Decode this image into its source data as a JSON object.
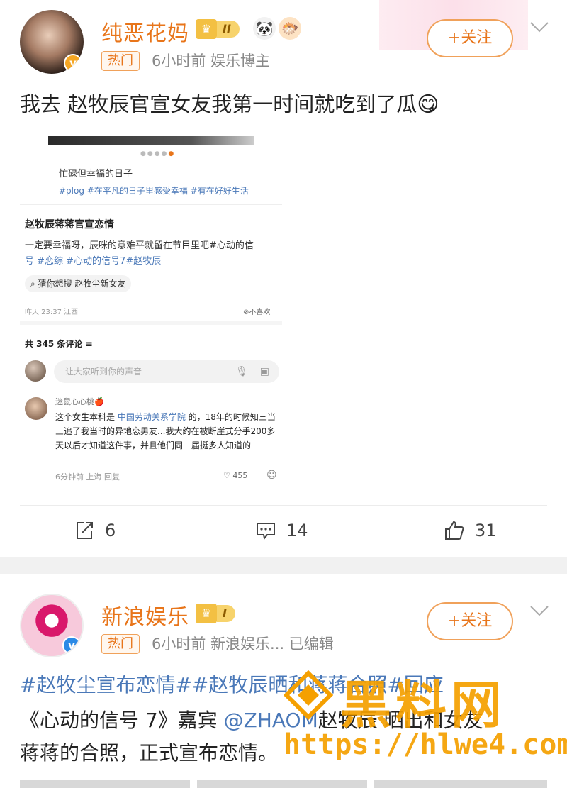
{
  "post1": {
    "username": "纯恶花妈",
    "rank_level": "II",
    "emoji_icons": [
      "panda-icon",
      "pufferfish-icon"
    ],
    "hot_tag": "热门",
    "meta": "6小时前  娱乐博主",
    "follow_label": "+关注",
    "text": "我去 赵牧辰官宣女友我第一时间就吃到了瓜",
    "embed": {
      "caption_title": "忙碌但幸福的日子",
      "caption_tags": "#plog #在平凡的日子里感受幸福 #有在好好生活",
      "article_title": "赵牧辰蒋蒋官宣恋情",
      "article_body_line1": "一定要幸福呀，辰咪的意难平就留在节目里吧#心动的信",
      "article_body_line2": "号 #恋综 #心动的信号7#赵牧辰",
      "guess_label": "猜你想搜  赵牧尘新女友",
      "published": "昨天 23:37 江西",
      "dislike": "不喜欢",
      "comment_count": "共 345 条评论",
      "comment_placeholder": "让大家听到你的声音",
      "comment": {
        "name": "迷鼠心心桃",
        "text_pre": "这个女生本科是 ",
        "text_link": "中国劳动关系学院",
        "text_post": " 的，18年的时候知三当三追了我当时的异地恋男友...我大约在被断崖式分手200多天以后才知道这件事，并且他们同一届挺多人知道的",
        "time_loc": "6分钟前 上海  回复",
        "likes": "455"
      }
    },
    "actions": {
      "share_count": "6",
      "comment_count": "14",
      "like_count": "31"
    }
  },
  "post2": {
    "username": "新浪娱乐",
    "rank_level": "I",
    "hot_tag": "热门",
    "meta": "6小时前  新浪娱乐...  已编辑",
    "follow_label": "+关注",
    "hashtags": "#赵牧尘宣布恋情##赵牧辰晒和蒋蒋合照#回应",
    "line2_pre": "《心动的信号 7》嘉宾 ",
    "line2_mention": "@ZHAOM",
    "line2_post": "赵牧辰 晒出和女友",
    "line3": "蒋蒋的合照，正式宣布恋情。"
  },
  "watermark": {
    "text": "黑料网",
    "url": "https://hlwe4.com"
  },
  "colors": {
    "accent_orange": "#e8751a",
    "link_blue": "#4a78b8",
    "watermark": "#f5a000"
  }
}
